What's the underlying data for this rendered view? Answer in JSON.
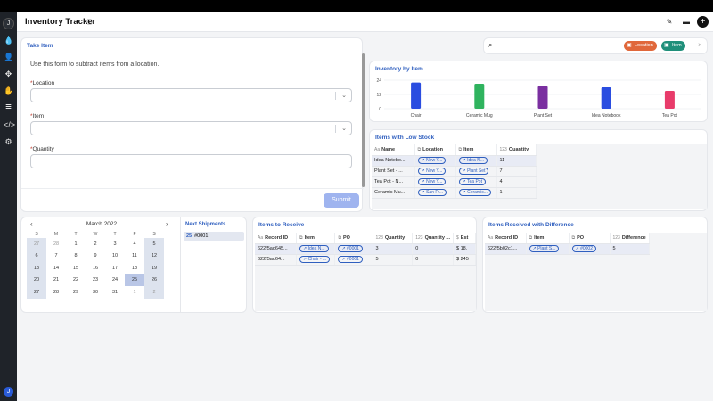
{
  "app": {
    "title": "Inventory Tracker",
    "info_icon": "info-icon",
    "header_icons": [
      "edit-icon",
      "layout-icon",
      "plus-icon"
    ],
    "add_label": "+"
  },
  "rail": {
    "logo_text": "J",
    "items": [
      "drop-icon",
      "user-add-icon",
      "move-icon",
      "hand-icon",
      "database-icon",
      "code-icon",
      "gear-icon"
    ],
    "bottom_logo_text": "J"
  },
  "take_item": {
    "title": "Take Item",
    "description": "Use this form to subtract items from a location.",
    "location_label": "Location",
    "item_label": "Item",
    "quantity_label": "Quantity",
    "required_mark": "*",
    "submit_label": "Submit"
  },
  "search": {
    "placeholder": "",
    "chips": [
      {
        "label": "Location",
        "color": "#e0673a"
      },
      {
        "label": "Item",
        "color": "#1f8f7a"
      }
    ],
    "clear_label": "×"
  },
  "inventory_chart": {
    "title": "Inventory by Item"
  },
  "chart_data": {
    "type": "bar",
    "categories": [
      "Chair",
      "Ceramic Mug",
      "Plant Set",
      "Idea Notebook",
      "Tea Pot"
    ],
    "values": [
      22,
      21,
      19,
      18,
      15
    ],
    "colors": [
      "#2a4de0",
      "#2fb35e",
      "#7a2fa0",
      "#2a4de0",
      "#e83b6a"
    ],
    "ylim": [
      0,
      24
    ],
    "yticks": [
      0,
      12,
      24
    ],
    "grid": true,
    "title": "",
    "xlabel": "",
    "ylabel": ""
  },
  "low_stock": {
    "title": "Items with Low Stock",
    "columns": [
      "Name",
      "Location",
      "Item",
      "Quantity"
    ],
    "rows": [
      {
        "name": "Idea Notebo...",
        "location": "New Y...",
        "item": "Idea N...",
        "quantity": "11"
      },
      {
        "name": "Plant Set - ...",
        "location": "New Y...",
        "item": "Plant Set",
        "quantity": "7"
      },
      {
        "name": "Tea Pot - N...",
        "location": "New Y...",
        "item": "Tea Pot",
        "quantity": "4"
      },
      {
        "name": "Ceramic Mu...",
        "location": "San Fr...",
        "item": "Ceramic...",
        "quantity": "1"
      }
    ]
  },
  "calendar": {
    "month": "March 2022",
    "prev": "‹",
    "next": "›",
    "weekdays": [
      "S",
      "M",
      "T",
      "W",
      "T",
      "F",
      "S"
    ],
    "weeks": [
      [
        "27",
        "28",
        "1",
        "2",
        "3",
        "4",
        "5"
      ],
      [
        "6",
        "7",
        "8",
        "9",
        "10",
        "11",
        "12"
      ],
      [
        "13",
        "14",
        "15",
        "16",
        "17",
        "18",
        "19"
      ],
      [
        "20",
        "21",
        "22",
        "23",
        "24",
        "25",
        "26"
      ],
      [
        "27",
        "28",
        "29",
        "30",
        "31",
        "1",
        "2"
      ]
    ],
    "next_shipments_title": "Next Shipments",
    "shipment_day": "25",
    "shipment_id": "#0001"
  },
  "to_receive": {
    "title": "Items to Receive",
    "columns": [
      "Record ID",
      "Item",
      "PO",
      "Quantity",
      "Quantity ...",
      "Est"
    ],
    "rows": [
      {
        "id": "622f5ad645...",
        "item": "Idea N...",
        "po": "#0001",
        "qty": "3",
        "qty2": "0",
        "est": "$ 18."
      },
      {
        "id": "622f5ad64...",
        "item": "Chair - ...",
        "po": "#0001",
        "qty": "5",
        "qty2": "0",
        "est": "$ 245"
      }
    ]
  },
  "received_diff": {
    "title": "Items Received with Difference",
    "columns": [
      "Record ID",
      "Item",
      "PO",
      "Difference"
    ],
    "rows": [
      {
        "id": "622f5b02c1...",
        "item": "Plant S...",
        "po": "#0002",
        "diff": "5"
      }
    ]
  }
}
